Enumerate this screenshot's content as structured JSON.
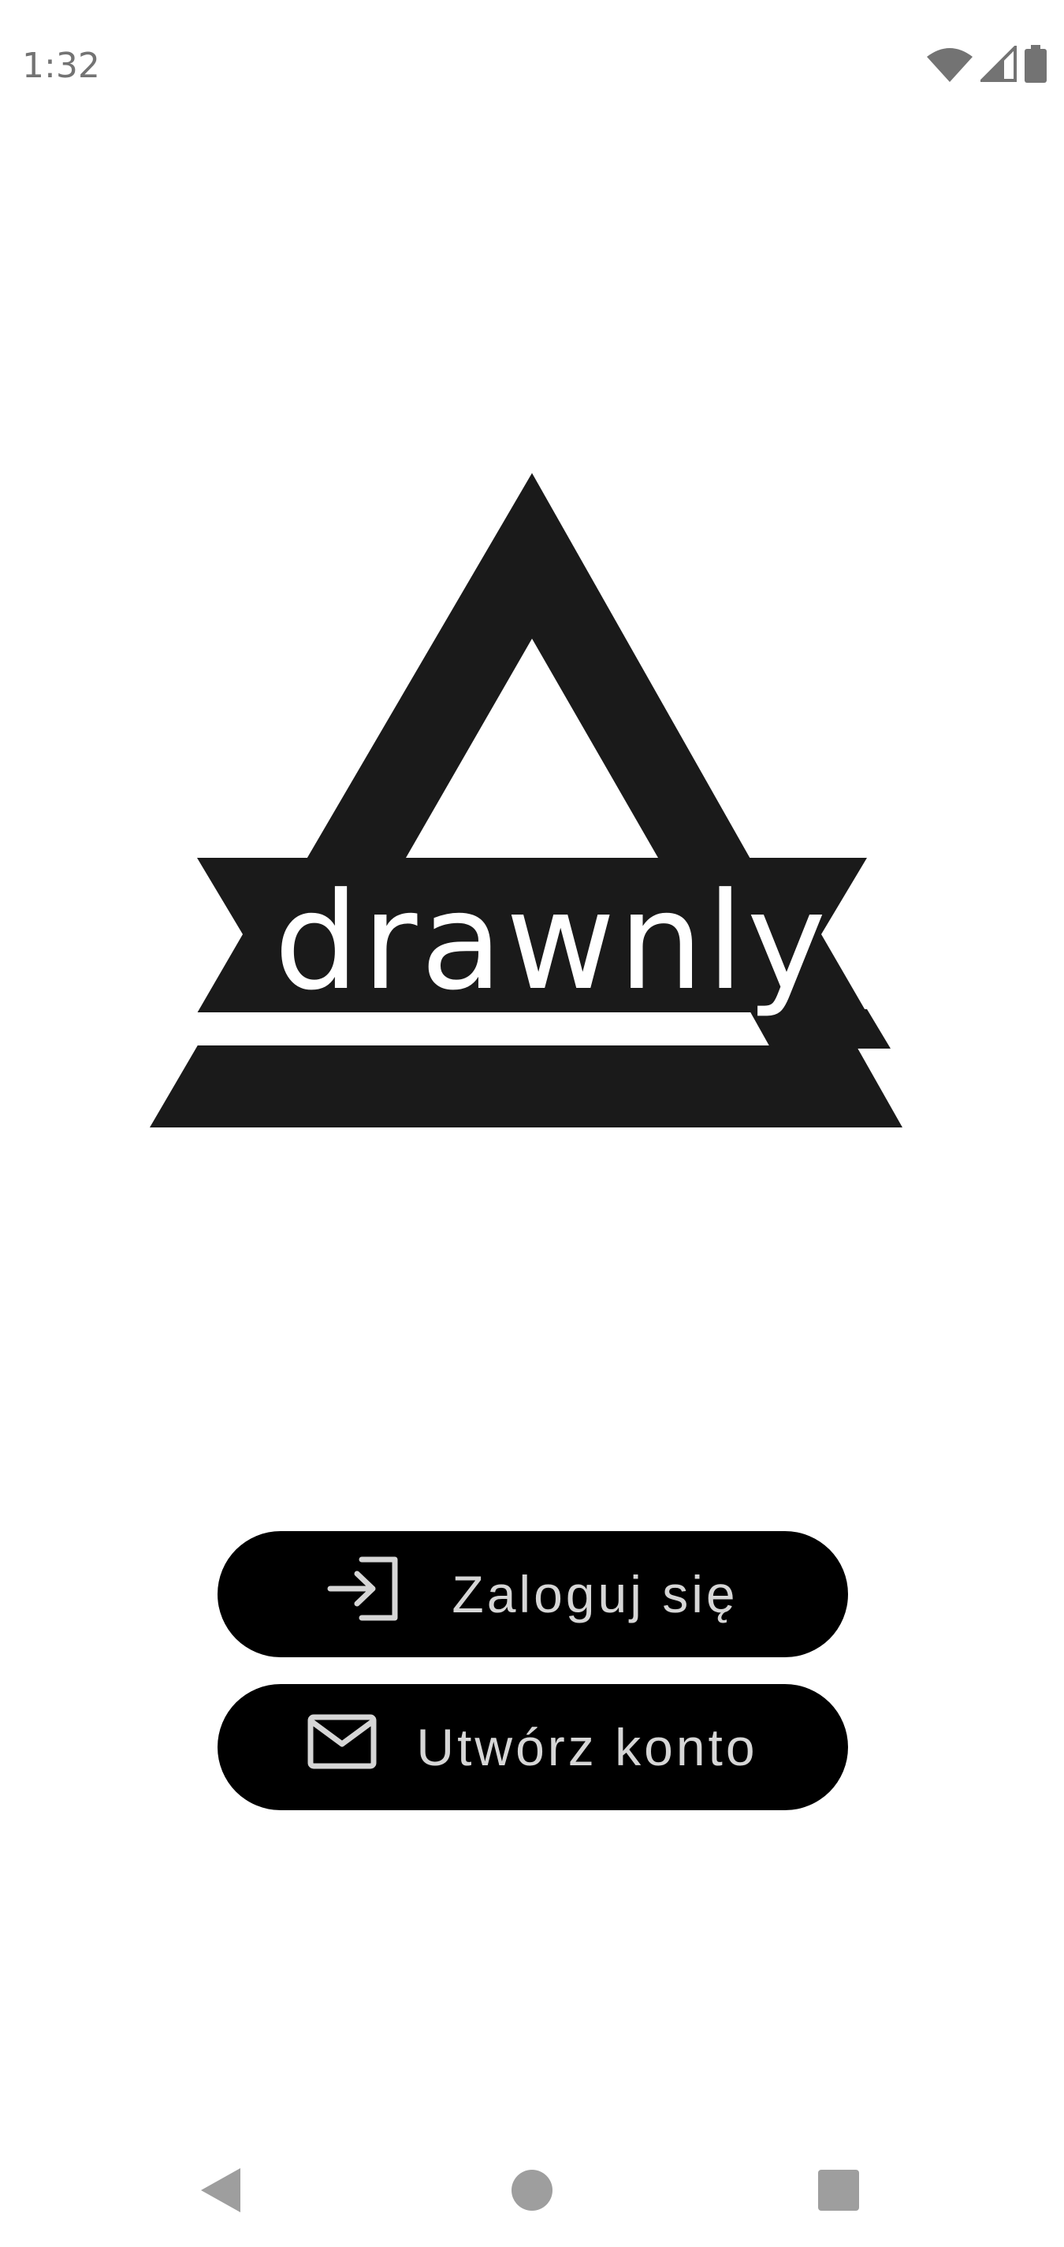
{
  "status_bar": {
    "time": "1:32",
    "icons": [
      "wifi-icon",
      "signal-icon",
      "battery-icon"
    ]
  },
  "logo": {
    "wordmark": "drawnly",
    "color": "#1a1a1a"
  },
  "actions": {
    "login": {
      "label": "Zaloguj się",
      "icon": "login-icon"
    },
    "signup": {
      "label": "Utwórz konto",
      "icon": "mail-icon"
    }
  },
  "nav_bar": {
    "icons": [
      "back-icon",
      "home-icon",
      "recents-icon"
    ]
  },
  "colors": {
    "background": "#ffffff",
    "button_background": "#000000",
    "button_text": "#d6d6d6",
    "system_icons": "#737373",
    "nav_icons": "#9e9e9e"
  }
}
